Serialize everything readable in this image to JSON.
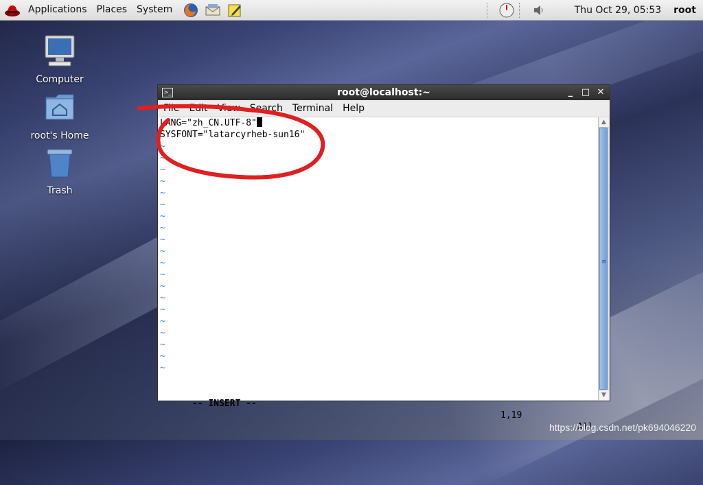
{
  "panel": {
    "menus": [
      "Applications",
      "Places",
      "System"
    ],
    "clock": "Thu Oct 29, 05:53",
    "user": "root"
  },
  "desktop": {
    "icons": [
      {
        "label": "Computer",
        "icon": "computer-icon"
      },
      {
        "label": "root's Home",
        "icon": "home-folder-icon"
      },
      {
        "label": "Trash",
        "icon": "trash-icon"
      }
    ]
  },
  "window": {
    "title": "root@localhost:~",
    "menus": [
      "File",
      "Edit",
      "View",
      "Search",
      "Terminal",
      "Help"
    ],
    "lines": [
      "LANG=\"zh_CN.UTF-8\"",
      "SYSFONT=\"latarcyrheb-sun16\""
    ],
    "tilde": "~",
    "status": {
      "mode": "-- INSERT --",
      "position": "1,19",
      "scroll": "All"
    }
  },
  "colors": {
    "annotation": "#e02020",
    "tilde": "#3a8cd6"
  },
  "watermark": "https://blog.csdn.net/pk694046220"
}
